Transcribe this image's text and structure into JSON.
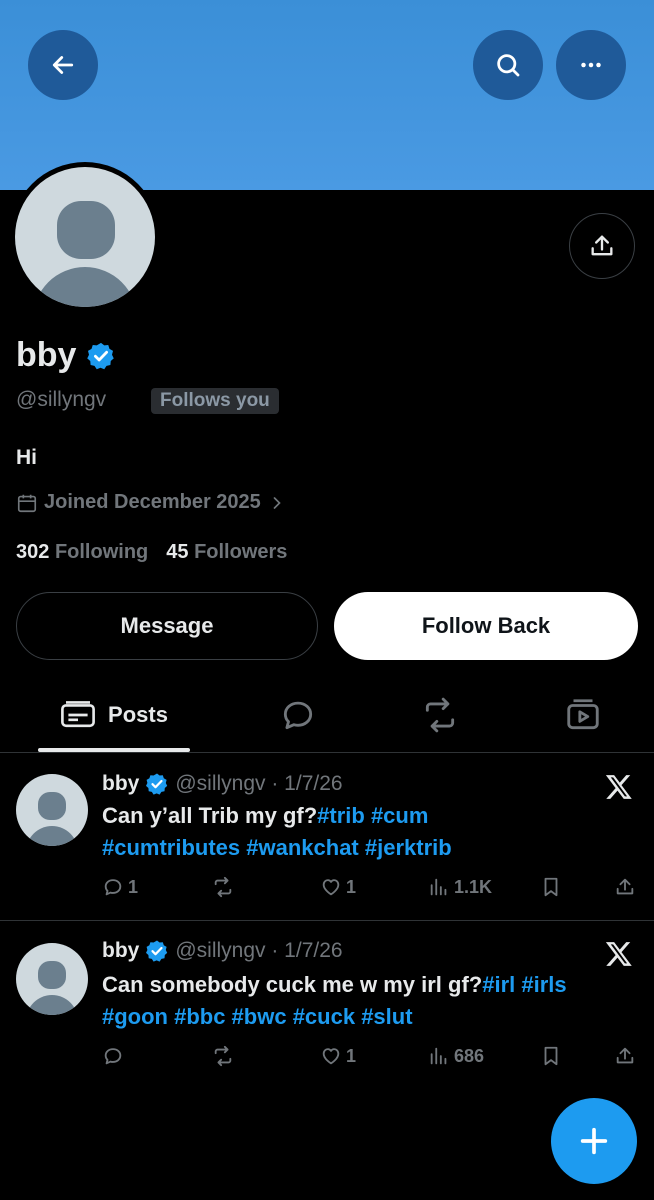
{
  "profile": {
    "name": "bby",
    "handle": "@sillyngv",
    "follows_you": "Follows you",
    "bio": "Hi",
    "joined": "Joined December 2025",
    "following_count": "302",
    "following_label": "Following",
    "followers_count": "45",
    "followers_label": "Followers"
  },
  "buttons": {
    "message": "Message",
    "follow_back": "Follow Back"
  },
  "tabs": {
    "posts": "Posts"
  },
  "posts": [
    {
      "name": "bby",
      "meta": "@sillyngv · 1/7/26",
      "text_plain": "Can y’all Trib my gf?",
      "tags_line1": "#trib #cum",
      "tags_line2": "#cumtributes #wankchat #jerktrib",
      "replies": "1",
      "likes": "1",
      "views": "1.1K"
    },
    {
      "name": "bby",
      "meta": "@sillyngv · 1/7/26",
      "text_plain": "Can somebody cuck me w my irl gf?",
      "tags_line1": "#irl #irls",
      "tags_line2": "#goon #bbc #bwc #cuck #slut",
      "replies": "",
      "likes": "1",
      "views": "686"
    }
  ],
  "colors": {
    "banner": "#4a9ae3",
    "accent": "#1d9bf0",
    "background": "#000000",
    "muted": "#71767b"
  }
}
